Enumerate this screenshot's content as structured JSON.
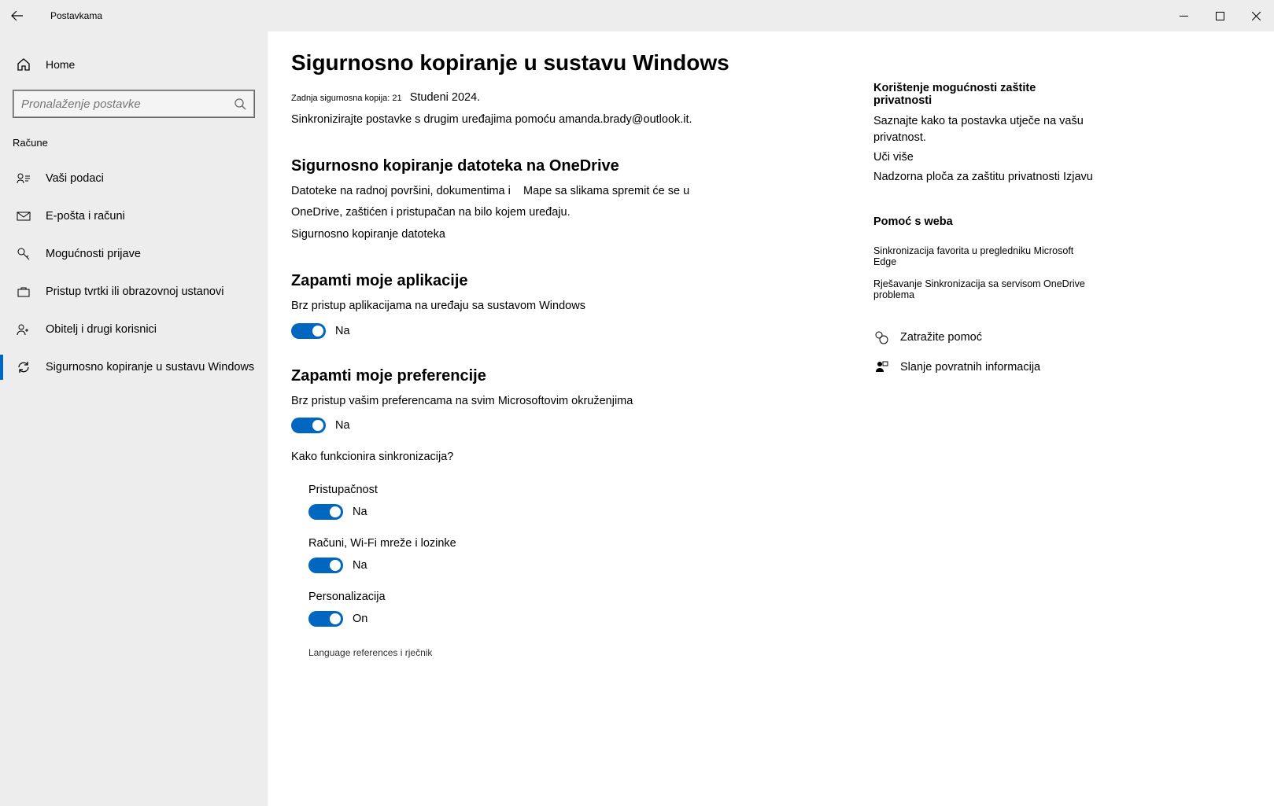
{
  "window": {
    "title": "Postavkama"
  },
  "sidebar": {
    "home": "Home",
    "search_placeholder": "Pronalaženje postavke",
    "section": "Računе",
    "items": [
      {
        "label": "Vaši podaci"
      },
      {
        "label": "E-pošta i računi"
      },
      {
        "label": "Mogućnosti prijave"
      },
      {
        "label": "Pristup tvrtki ili obrazovnoj ustanovi"
      },
      {
        "label": "Obitelj i drugi korisnici"
      },
      {
        "label": "Sigurnosno kopiranje u sustavu Windows"
      }
    ]
  },
  "main": {
    "title": "Sigurnosno kopiranje u sustavu Windows",
    "last_backup_prefix": "Zadnja sigurnosna kopija: 21",
    "last_backup_date": "Studeni 2024.",
    "sync_text": "Sinkronizirajte postavke s drugim uređajima pomoću amanda.brady@outlook.it.",
    "onedrive": {
      "title": "Sigurnosno kopiranje datoteka na OneDrive",
      "desc1": "Datoteke na radnoj površini, dokumentima i",
      "desc1b": "Mape sa slikama spremit će se u",
      "desc2": "OneDrive, zaštićen i pristupačan na bilo kojem uređaju.",
      "link": "Sigurnosno kopiranje datoteka"
    },
    "apps": {
      "title": "Zapamti moje aplikacije",
      "desc": "Brz pristup aplikacijama na uređaju sa sustavom Windows",
      "state": "Na"
    },
    "prefs": {
      "title": "Zapamti moje preferencije",
      "desc": "Brz pristup vašim preferencama na svim Microsoftovim okruženjima",
      "state": "Na",
      "how_link": "Kako funkcionira sinkronizacija?",
      "items": [
        {
          "label": "Pristupačnost",
          "state": "Na"
        },
        {
          "label": "Računi, Wi-Fi mreže i lozinke",
          "state": "Na"
        },
        {
          "label": "Personalizacija",
          "state": "On"
        }
      ],
      "truncated": "Language references i rječnik"
    }
  },
  "right": {
    "privacy": {
      "title": "Korištenje mogućnosti zaštite privatnosti",
      "desc": "Saznajte kako ta postavka utječe na vašu privatnost.",
      "learn": "Uči više",
      "dashboard": "Nadzorna ploča za zaštitu privatnosti Izjavu"
    },
    "webhelp": {
      "title": "Pomoć s weba",
      "links": [
        "Sinkronizacija favorita u pregledniku Microsoft Edge",
        "Rješavanje Sinkronizacija sa servisom OneDrive problema"
      ]
    },
    "actions": {
      "get_help": "Zatražite pomoć",
      "feedback": "Slanje povratnih informacija"
    }
  }
}
